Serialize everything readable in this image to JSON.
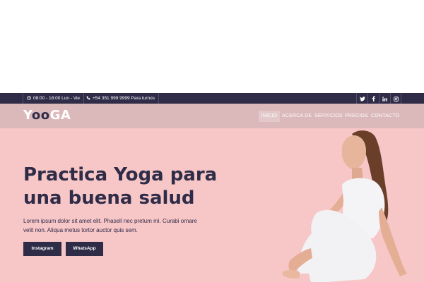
{
  "topbar": {
    "hours": "08:00 - 18:00  Lun - Vie",
    "phone": "+54 351 999 9999  Para turnos",
    "social_icons": [
      "twitter-icon",
      "facebook-icon",
      "linkedin-icon",
      "instagram-icon"
    ]
  },
  "nav": {
    "logo_prefix": "Y",
    "logo_middle": "oo",
    "logo_suffix": "GA",
    "items": [
      "INICIO",
      "ACERCA DE",
      "SERVICIOS",
      "PRECIOS",
      "CONTACTO"
    ],
    "active_index": 0
  },
  "hero": {
    "title": "Practica Yoga para una buena salud",
    "text": "Lorem ipsum dolor sit amet elit. Phasell nec pretum mi. Curabi ornare velit non. Aliqua metus tortor auctor quis sem.",
    "buttons": [
      "Instagram",
      "WhatsApp"
    ]
  },
  "colors": {
    "dark": "#2f2c48",
    "nav_bg": "#dbb8ba",
    "hero_bg": "#f7c6c7"
  }
}
